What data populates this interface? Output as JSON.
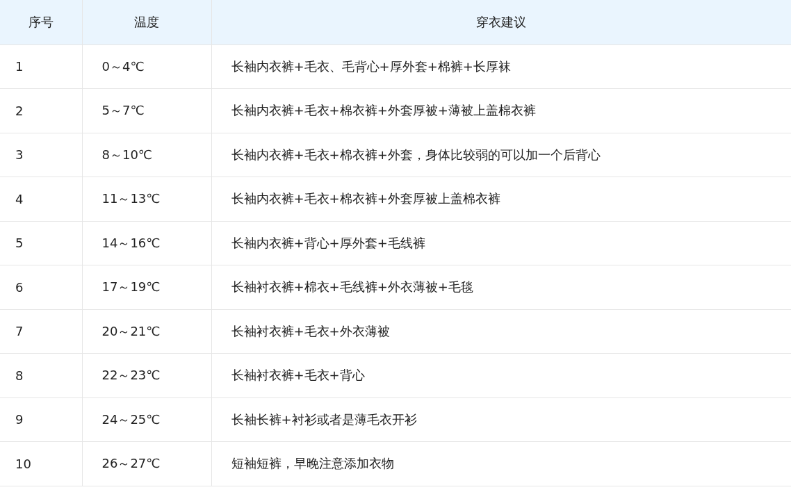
{
  "table": {
    "columns": [
      "序号",
      "温度",
      "穿衣建议"
    ],
    "rows": [
      [
        "1",
        "0～4℃",
        "长袖内衣裤+毛衣、毛背心+厚外套+棉裤+长厚袜"
      ],
      [
        "2",
        "5～7℃",
        "长袖内衣裤+毛衣+棉衣裤+外套厚被+薄被上盖棉衣裤"
      ],
      [
        "3",
        "8～10℃",
        "长袖内衣裤+毛衣+棉衣裤+外套，身体比较弱的可以加一个后背心"
      ],
      [
        "4",
        "11～13℃",
        "长袖内衣裤+毛衣+棉衣裤+外套厚被上盖棉衣裤"
      ],
      [
        "5",
        "14～16℃",
        "长袖内衣裤+背心+厚外套+毛线裤"
      ],
      [
        "6",
        "17～19℃",
        "长袖衬衣裤+棉衣+毛线裤+外衣薄被+毛毯"
      ],
      [
        "7",
        "20～21℃",
        "长袖衬衣裤+毛衣+外衣薄被"
      ],
      [
        "8",
        "22～23℃",
        "长袖衬衣裤+毛衣+背心"
      ],
      [
        "9",
        "24～25℃",
        "长袖长裤+衬衫或者是薄毛衣开衫"
      ],
      [
        "10",
        "26～27℃",
        "短袖短裤，早晚注意添加衣物"
      ]
    ]
  }
}
